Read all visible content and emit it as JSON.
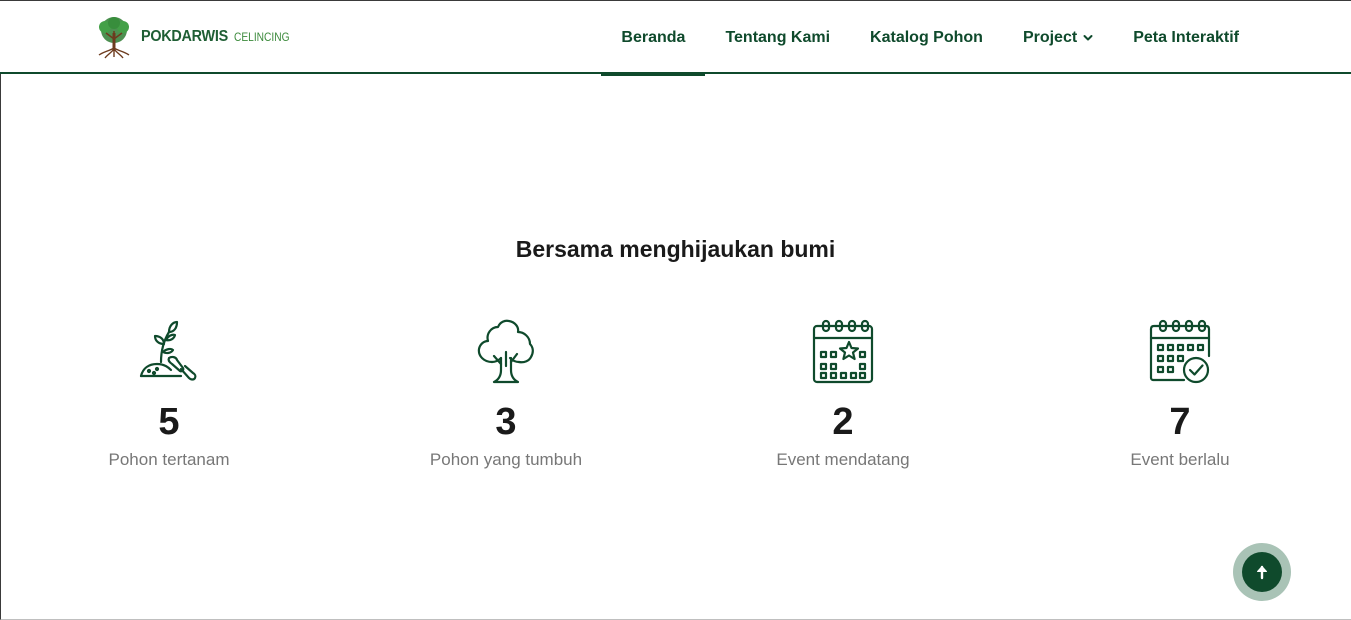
{
  "brand": {
    "name": "POKDARWIS",
    "subtitle": "CELINCING",
    "logo": "tree-logo-icon"
  },
  "nav": {
    "items": [
      {
        "label": "Beranda",
        "active": true
      },
      {
        "label": "Tentang Kami",
        "active": false
      },
      {
        "label": "Katalog Pohon",
        "active": false
      },
      {
        "label": "Project",
        "active": false,
        "dropdown": true
      },
      {
        "label": "Peta Interaktif",
        "active": false
      }
    ]
  },
  "main": {
    "title": "Bersama menghijaukan bumi",
    "stats": [
      {
        "icon": "sprout-shovel-icon",
        "number": "5",
        "label": "Pohon tertanam"
      },
      {
        "icon": "tree-icon",
        "number": "3",
        "label": "Pohon yang tumbuh"
      },
      {
        "icon": "calendar-star-icon",
        "number": "2",
        "label": "Event mendatang"
      },
      {
        "icon": "calendar-check-icon",
        "number": "7",
        "label": "Event berlalu"
      }
    ]
  },
  "scroll_top": {
    "icon": "arrow-up-icon"
  },
  "colors": {
    "primary": "#0f4a2c",
    "brand_green": "#1f5e34",
    "muted_text": "#777777",
    "scroll_ring": "#a9c3b6"
  }
}
